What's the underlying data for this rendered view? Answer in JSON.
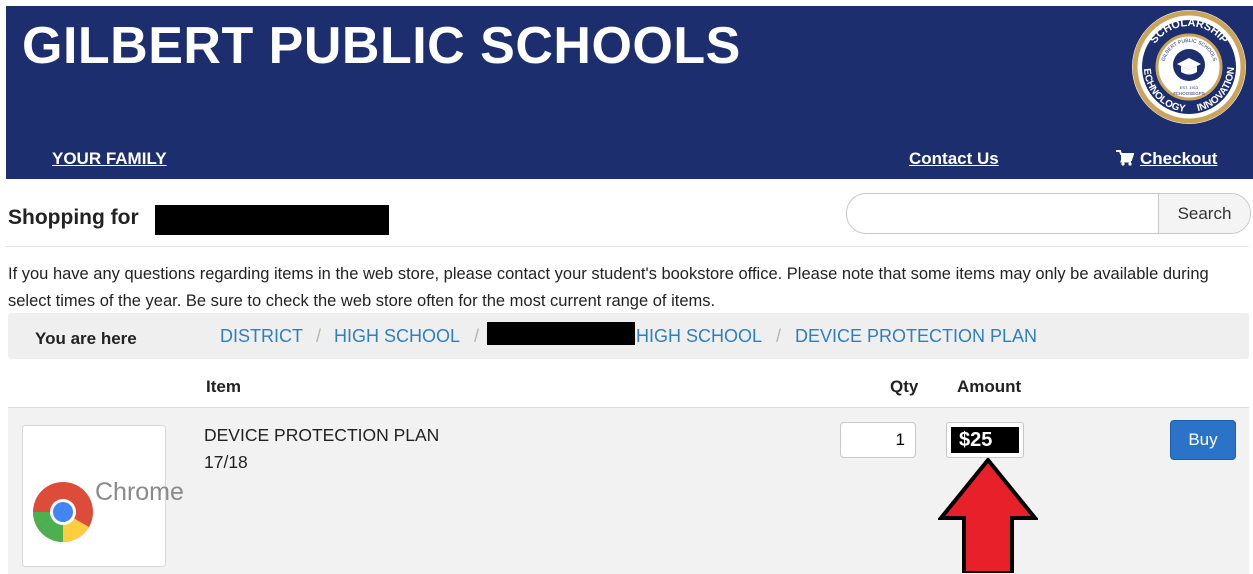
{
  "header": {
    "title": "GILBERT PUBLIC SCHOOLS",
    "seal_text": {
      "top": "SCHOLARSHIP",
      "left": "TECHNOLOGY",
      "right": "INNOVATION",
      "inner": "GILBERT PUBLIC SCHOOLS",
      "est": "EST. 1913",
      "tag": "#CHOOSEGPS"
    },
    "nav": {
      "family": "YOUR FAMILY",
      "contact": "Contact Us",
      "checkout": "Checkout"
    },
    "color": "#1c2e6e"
  },
  "shopping": {
    "label": "Shopping for"
  },
  "search": {
    "placeholder": "",
    "button": "Search"
  },
  "notice": "If you have any questions regarding items in the web store, please contact your student's bookstore office.  Please note that some items may only be available during select times of the year.  Be sure to check the web store often for the most current range of items.",
  "breadcrumb": {
    "label": "You are here",
    "items": [
      "DISTRICT",
      "HIGH SCHOOL",
      "HIGH SCHOOL",
      "DEVICE PROTECTION PLAN"
    ],
    "separator": "/",
    "color": "#2f7fbf"
  },
  "table": {
    "headers": {
      "item": "Item",
      "qty": "Qty",
      "amount": "Amount"
    },
    "rows": [
      {
        "name": "DEVICE PROTECTION PLAN",
        "term": "17/18",
        "qty": "1",
        "amount": "$25",
        "buy": "Buy",
        "image_label": "Chrome"
      }
    ]
  },
  "icons": {
    "cart": "cart-icon",
    "chrome": "chrome-logo",
    "arrow": "red-arrow-up"
  },
  "colors": {
    "arrow": "#e8202a",
    "buy": "#2a73c8"
  }
}
